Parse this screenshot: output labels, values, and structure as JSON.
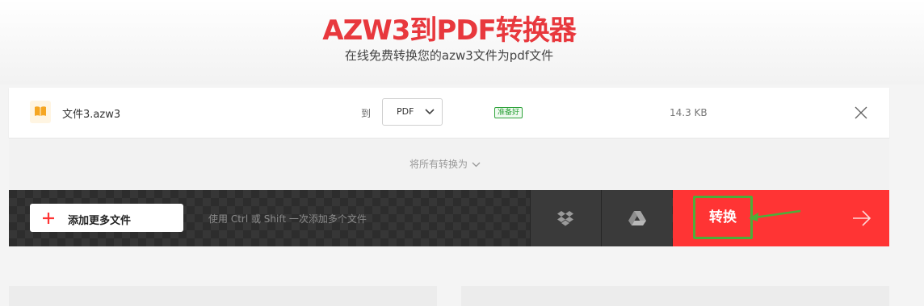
{
  "header": {
    "title": "AZW3到PDF转换器",
    "subtitle": "在线免费转换您的azw3文件为pdf文件"
  },
  "file": {
    "name": "文件3.azw3",
    "to_label": "到",
    "format": "PDF",
    "status": "准备好",
    "size": "14.3 KB"
  },
  "convert_all_label": "将所有转换为",
  "actions": {
    "add_files": "添加更多文件",
    "hint": "使用 Ctrl 或 Shift 一次添加多个文件",
    "convert": "转换"
  },
  "icons": {
    "file": "book-icon",
    "remove": "close-icon",
    "dropbox": "dropbox-icon",
    "gdrive": "google-drive-icon",
    "add": "plus-icon",
    "next": "arrow-right-icon"
  },
  "colors": {
    "brand_red": "#ff3434",
    "title_red": "#e8383d",
    "ready_green": "#2fa33b",
    "annotation_green": "#4cae3a",
    "action_bar": "#2d2d2d"
  }
}
